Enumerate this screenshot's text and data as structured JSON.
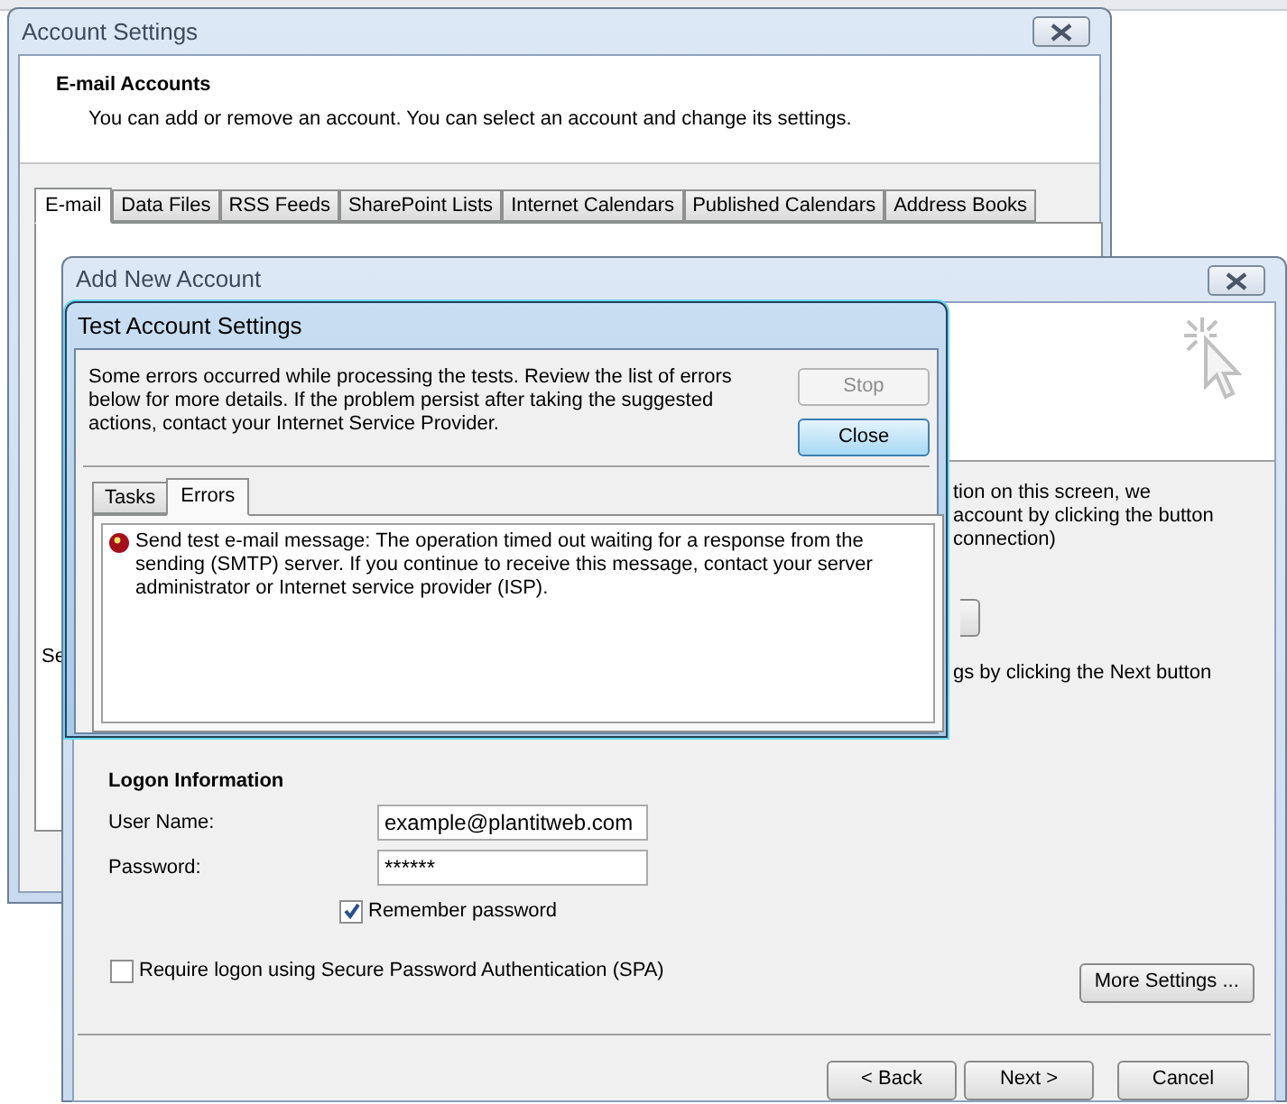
{
  "account_settings": {
    "title": "Account Settings",
    "heading": "E-mail Accounts",
    "subtitle": "You can add or remove an account. You can select an account and change its settings.",
    "tabs": [
      {
        "label": "E-mail",
        "selected": true
      },
      {
        "label": "Data Files",
        "selected": false
      },
      {
        "label": "RSS Feeds",
        "selected": false
      },
      {
        "label": "SharePoint Lists",
        "selected": false
      },
      {
        "label": "Internet Calendars",
        "selected": false
      },
      {
        "label": "Published Calendars",
        "selected": false
      },
      {
        "label": "Address Books",
        "selected": false
      }
    ],
    "partial_text": "Se"
  },
  "add_new_account": {
    "title": "Add New Account",
    "partial_lines": [
      "tion on this screen, we",
      "account by clicking the button",
      "connection)"
    ],
    "partial_line_2": "gs by clicking the Next button",
    "logon": {
      "heading": "Logon Information",
      "user_name_label": "User Name:",
      "user_name": "example@plantitweb.com",
      "password_label": "Password:",
      "password": "******",
      "remember": {
        "label": "Remember password",
        "checked": true
      },
      "spa": {
        "label": "Require logon using Secure Password Authentication (SPA)",
        "checked": false
      }
    },
    "more_settings": "More Settings ...",
    "buttons": [
      "< Back",
      "Next >",
      "Cancel"
    ]
  },
  "test_account_settings": {
    "title": "Test Account Settings",
    "message": "Some errors occurred while processing the tests. Review the list of errors below for more details. If the problem persist after taking the suggested actions, contact your Internet Service Provider.",
    "buttons": [
      {
        "label": "Stop",
        "disabled": true,
        "default": false
      },
      {
        "label": "Close",
        "disabled": false,
        "default": true
      }
    ],
    "tabs": [
      {
        "label": "Tasks",
        "selected": false
      },
      {
        "label": "Errors",
        "selected": true
      }
    ],
    "errors": [
      {
        "text": "Send test e-mail message: The operation timed out waiting for a response from the sending (SMTP) server. If you continue to receive this message, contact your server administrator or Internet service provider (ISP)."
      }
    ]
  }
}
